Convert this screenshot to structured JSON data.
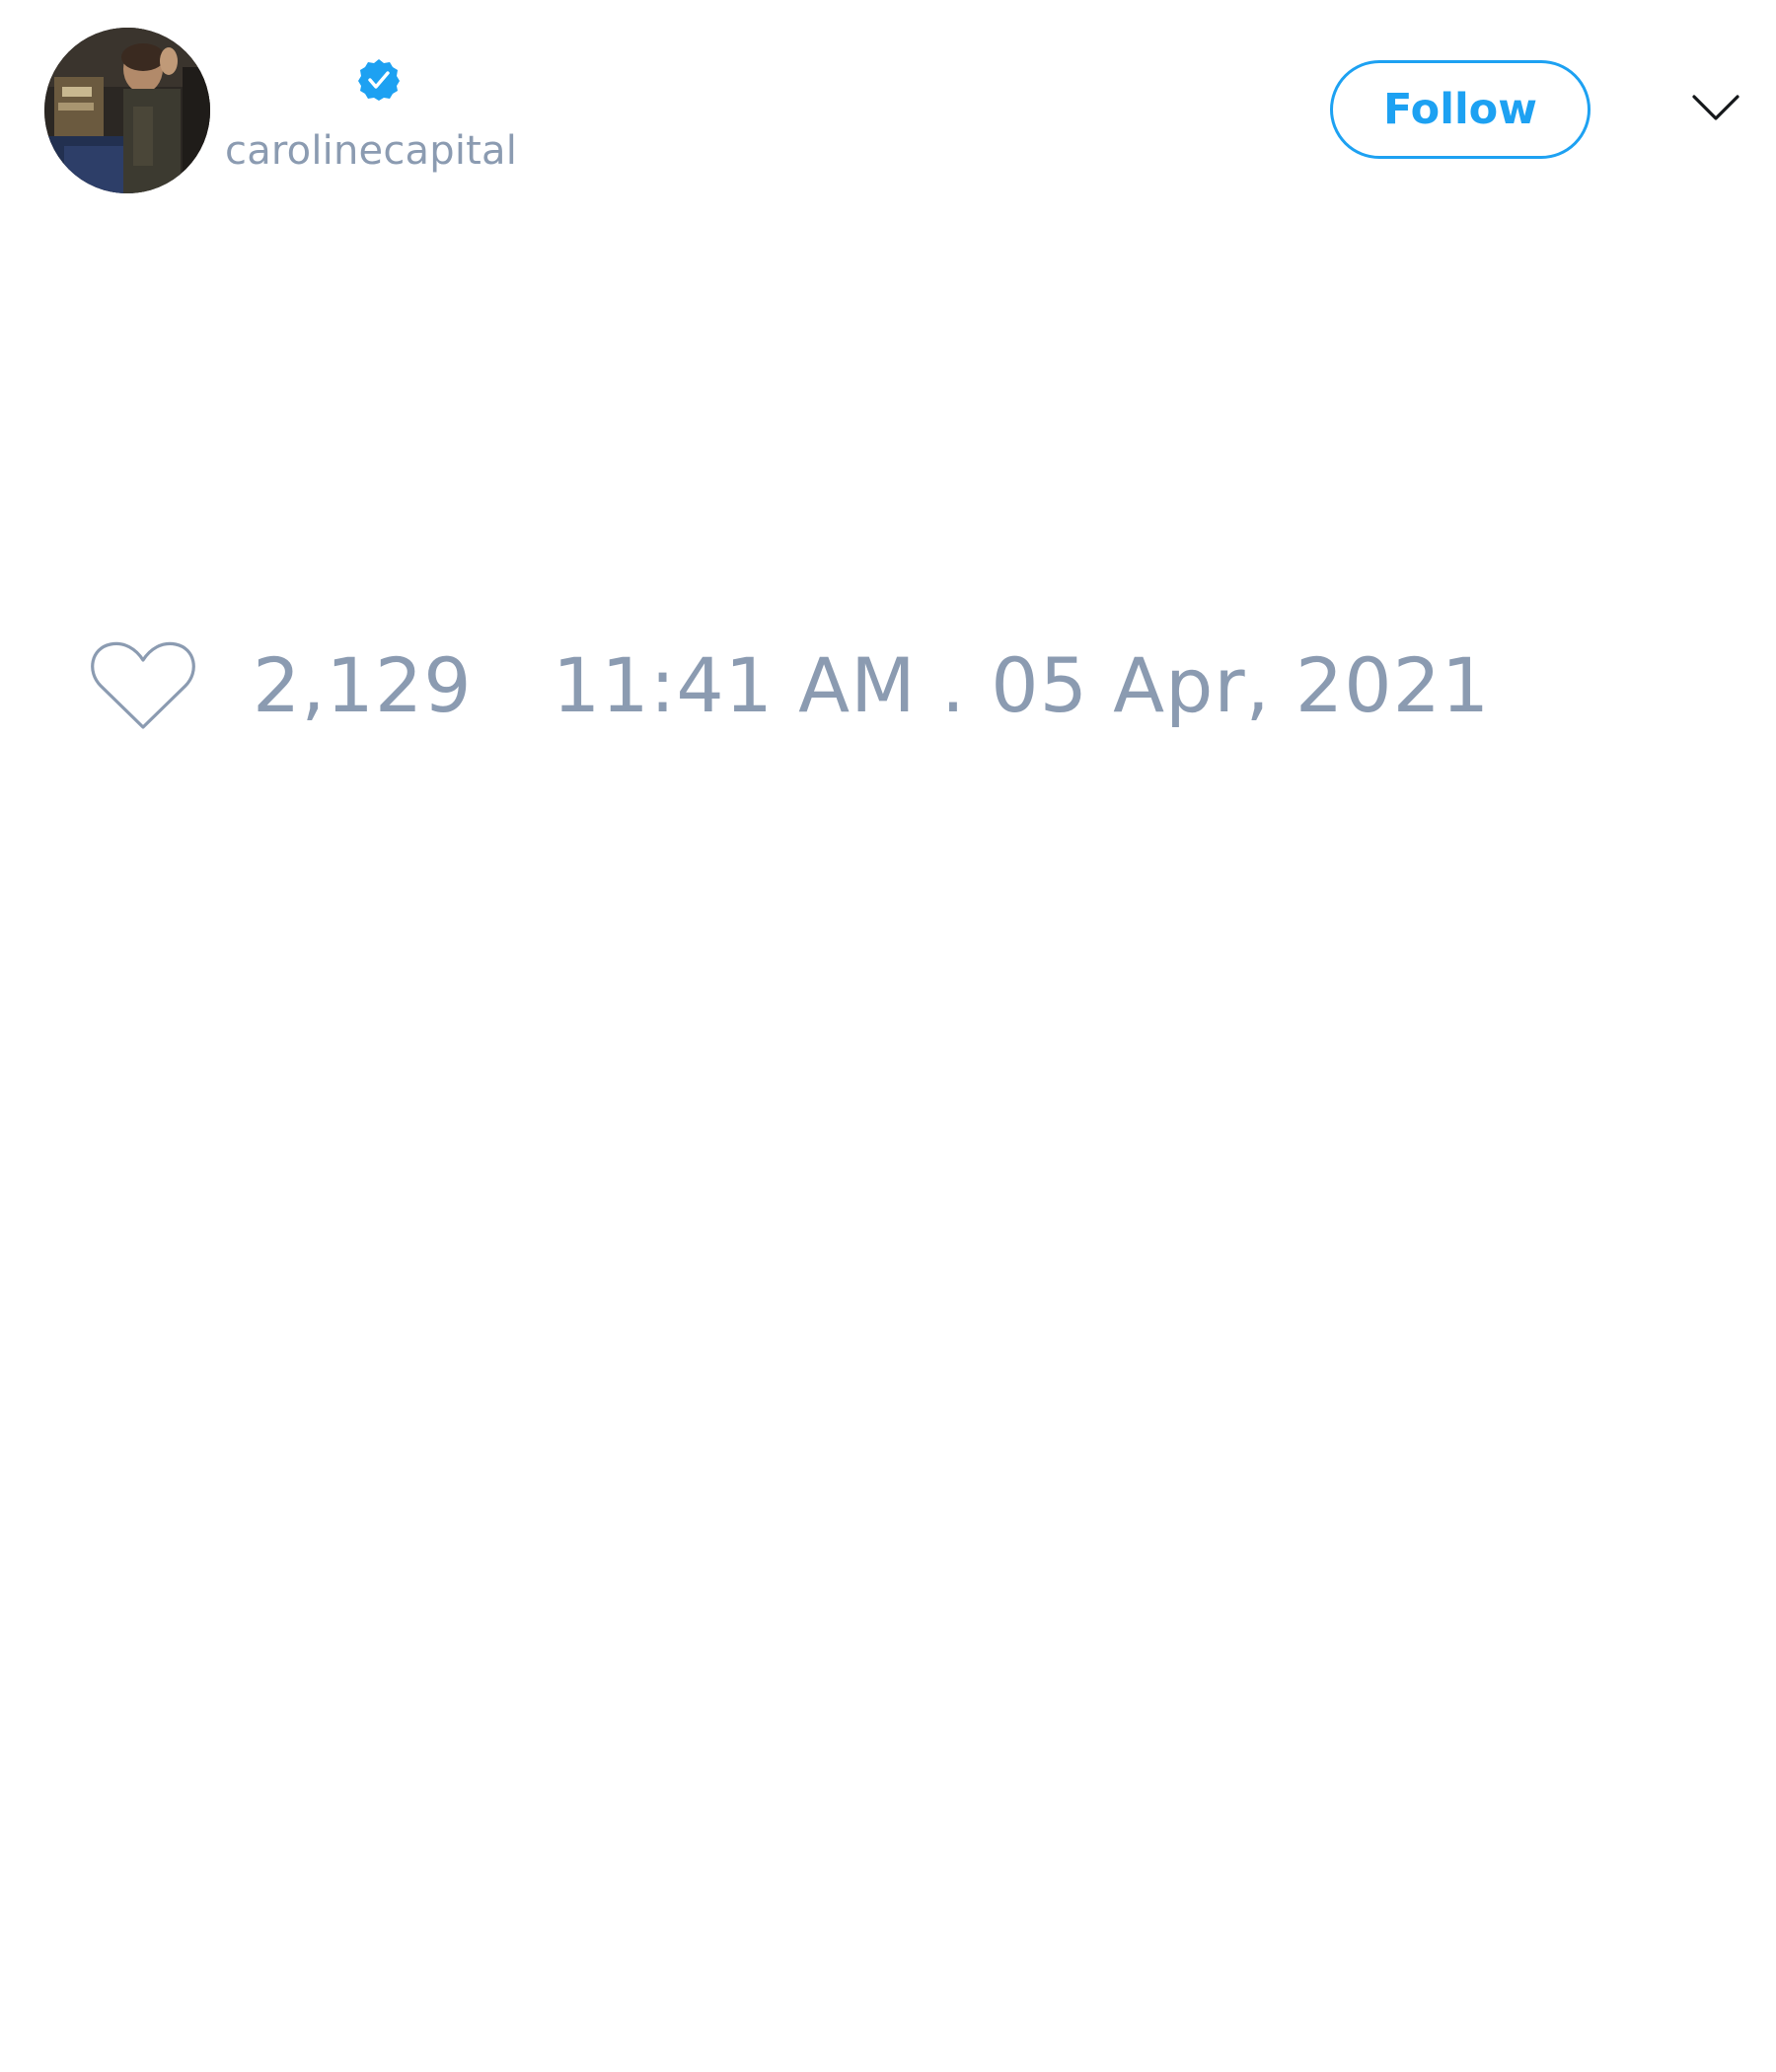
{
  "tweet": {
    "author": {
      "handle": "carolinecapital",
      "verified": true,
      "avatar_icon": "profile-photo"
    },
    "follow_button_label": "Follow",
    "menu_icon": "chevron-down-icon",
    "likes": {
      "icon": "heart-icon",
      "count": "2,129"
    },
    "timestamp": "11:41 AM . 05 Apr, 2021"
  },
  "colors": {
    "accent": "#1da1f2",
    "muted_text": "#8b9bb1",
    "background": "#ffffff"
  }
}
